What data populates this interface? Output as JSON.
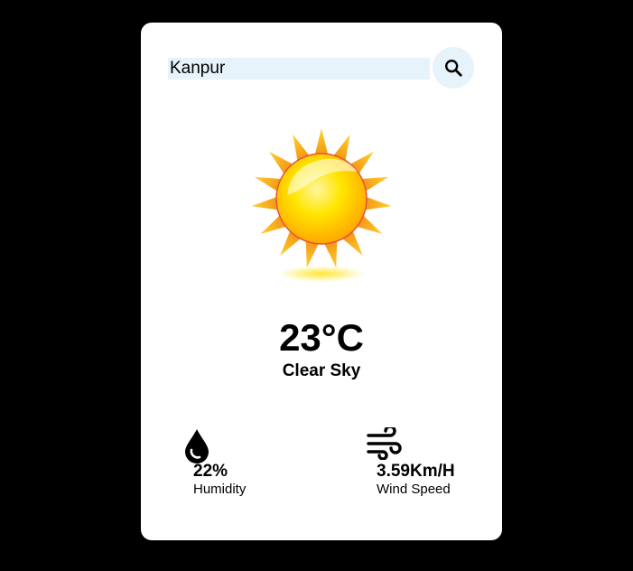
{
  "search": {
    "value": "Kanpur",
    "button_icon": "search-icon"
  },
  "weather": {
    "icon": "sun-icon",
    "temperature": "23°C",
    "condition": "Clear Sky"
  },
  "humidity": {
    "icon": "water-drop-icon",
    "value": "22%",
    "label": "Humidity"
  },
  "wind": {
    "icon": "wind-icon",
    "value": "3.59Km/H",
    "label": "Wind Speed"
  },
  "colors": {
    "page_background": "#000000",
    "card_background": "#ffffff",
    "input_background": "#e6f3fa",
    "sun_core": "#ffd200",
    "sun_rays": "#f5a020"
  }
}
